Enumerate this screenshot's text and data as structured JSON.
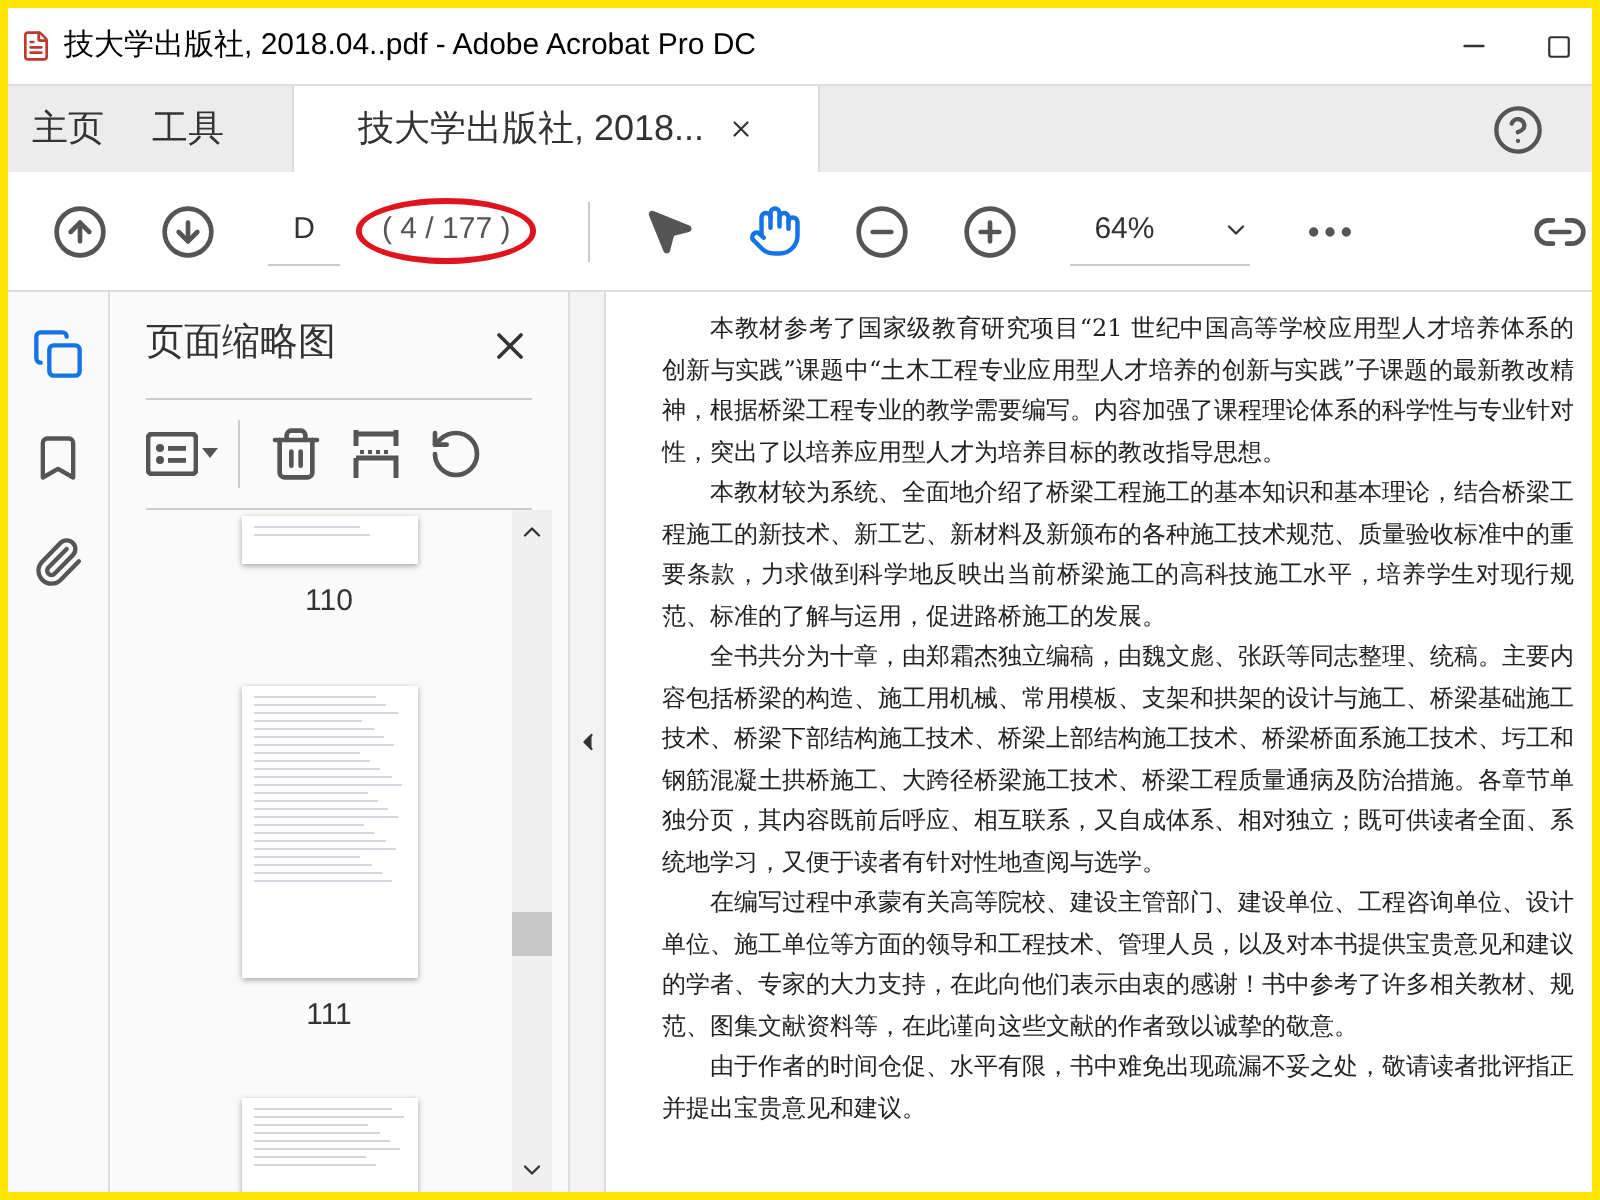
{
  "window": {
    "title": "技大学出版社, 2018.04..pdf - Adobe Acrobat Pro DC"
  },
  "tabs": [
    {
      "label": "主页",
      "selected": false
    },
    {
      "label": "工具",
      "selected": false
    },
    {
      "label": "技大学出版社, 2018...",
      "selected": true
    }
  ],
  "toolbar": {
    "page_field": "D",
    "page_count": "( 4 / 177 )",
    "zoom": "64%",
    "tools": [
      {
        "kind": "select",
        "selected": false
      },
      {
        "kind": "hand",
        "selected": true
      }
    ]
  },
  "side_rail": [
    {
      "kind": "pages",
      "selected": true
    },
    {
      "kind": "bookmarks",
      "selected": false
    },
    {
      "kind": "attachments",
      "selected": false
    }
  ],
  "thumbnail_panel": {
    "title": "页面缩略图",
    "pages": [
      {
        "kind": "bottom",
        "label": "110"
      },
      {
        "kind": "full",
        "label": "111"
      },
      {
        "kind": "top"
      }
    ]
  },
  "document": {
    "paragraphs": [
      "本教材参考了国家级教育研究项目“21 世纪中国高等学校应用型人才培养体系的创新与实践”课题中“土木工程专业应用型人才培养的创新与实践”子课题的最新教改精神，根据桥梁工程专业的教学需要编写。内容加强了课程理论体系的科学性与专业针对性，突出了以培养应用型人才为培养目标的教改指导思想。",
      "本教材较为系统、全面地介绍了桥梁工程施工的基本知识和基本理论，结合桥梁工程施工的新技术、新工艺、新材料及新颁布的各种施工技术规范、质量验收标准中的重要条款，力求做到科学地反映出当前桥梁施工的高科技施工水平，培养学生对现行规范、标准的了解与运用，促进路桥施工的发展。",
      "全书共分为十章，由郑霜杰独立编稿，由魏文彪、张跃等同志整理、统稿。主要内容包括桥梁的构造、施工用机械、常用模板、支架和拱架的设计与施工、桥梁基础施工技术、桥梁下部结构施工技术、桥梁上部结构施工技术、桥梁桥面系施工技术、圬工和钢筋混凝土拱桥施工、大跨径桥梁施工技术、桥梁工程质量通病及防治措施。各章节单独分页，其内容既前后呼应、相互联系，又自成体系、相对独立；既可供读者全面、系统地学习，又便于读者有针对性地查阅与选学。",
      "在编写过程中承蒙有关高等院校、建设主管部门、建设单位、工程咨询单位、设计单位、施工单位等方面的领导和工程技术、管理人员，以及对本书提供宝贵意见和建议的学者、专家的大力支持，在此向他们表示由衷的感谢！书中参考了许多相关教材、规范、图集文献资料等，在此谨向这些文献的作者致以诚挚的敬意。",
      "由于作者的时间仓促、水平有限，书中难免出现疏漏不妥之处，敬请读者批评指正并提出宝贵意见和建议。"
    ]
  }
}
